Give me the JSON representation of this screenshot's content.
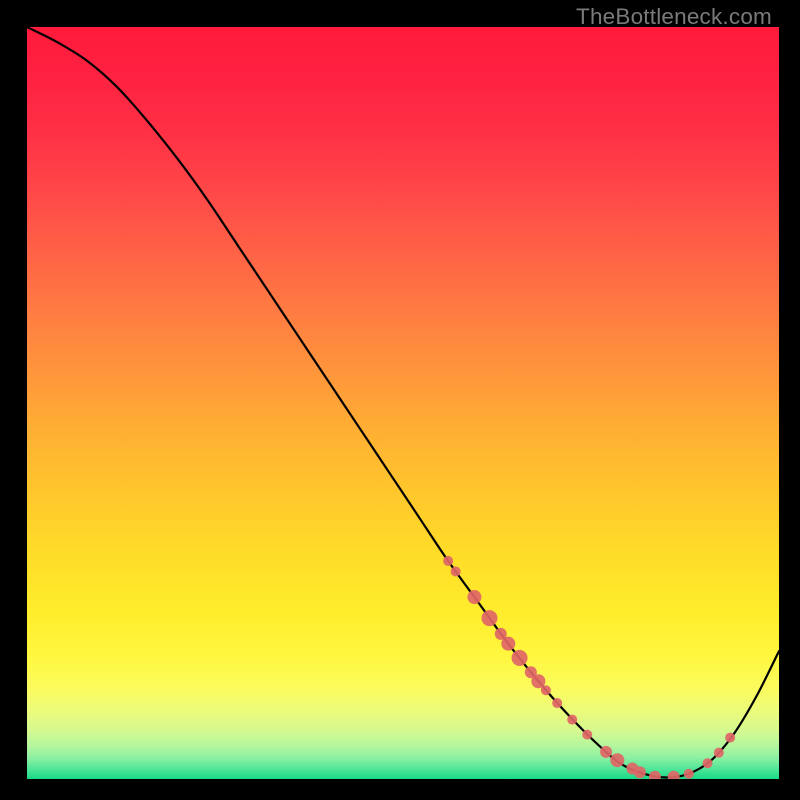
{
  "watermark": "TheBottleneck.com",
  "colors": {
    "gradient_stops": [
      {
        "offset": 0.0,
        "color": "#ff1a3a"
      },
      {
        "offset": 0.06,
        "color": "#ff2141"
      },
      {
        "offset": 0.14,
        "color": "#ff3045"
      },
      {
        "offset": 0.22,
        "color": "#ff4848"
      },
      {
        "offset": 0.3,
        "color": "#ff6246"
      },
      {
        "offset": 0.38,
        "color": "#ff7c42"
      },
      {
        "offset": 0.46,
        "color": "#ff963b"
      },
      {
        "offset": 0.54,
        "color": "#ffb033"
      },
      {
        "offset": 0.62,
        "color": "#ffc72c"
      },
      {
        "offset": 0.7,
        "color": "#ffdc28"
      },
      {
        "offset": 0.78,
        "color": "#ffed2c"
      },
      {
        "offset": 0.84,
        "color": "#fff741"
      },
      {
        "offset": 0.88,
        "color": "#fbfb5e"
      },
      {
        "offset": 0.91,
        "color": "#ecfb7b"
      },
      {
        "offset": 0.935,
        "color": "#d6f98f"
      },
      {
        "offset": 0.955,
        "color": "#b6f69d"
      },
      {
        "offset": 0.972,
        "color": "#8cf0a1"
      },
      {
        "offset": 0.985,
        "color": "#57e79a"
      },
      {
        "offset": 1.0,
        "color": "#17da87"
      }
    ],
    "curve": "#000000",
    "dot_fill": "#e06666",
    "dot_stroke": "#d85a5a"
  },
  "chart_data": {
    "type": "line",
    "title": "",
    "xlabel": "",
    "ylabel": "",
    "xlim": [
      0,
      100
    ],
    "ylim": [
      0,
      100
    ],
    "series": [
      {
        "name": "bottleneck-curve",
        "x": [
          0,
          4,
          8,
          12,
          16,
          20,
          24,
          28,
          32,
          36,
          40,
          44,
          48,
          52,
          56,
          60,
          64,
          68,
          72,
          76,
          79,
          82,
          85,
          88,
          91,
          94,
          97,
          100
        ],
        "y": [
          100,
          98,
          95.5,
          92,
          87.5,
          82.5,
          77,
          71,
          65,
          59,
          53,
          47,
          41,
          35,
          29,
          23.5,
          18,
          13,
          8.5,
          4.5,
          2.0,
          0.7,
          0.2,
          0.7,
          2.5,
          6.0,
          11,
          17
        ]
      }
    ],
    "dots": {
      "name": "highlight-points",
      "points": [
        {
          "x": 56.0,
          "y": 29.0,
          "r": 5
        },
        {
          "x": 57.0,
          "y": 27.6,
          "r": 5
        },
        {
          "x": 59.5,
          "y": 24.2,
          "r": 7
        },
        {
          "x": 61.5,
          "y": 21.4,
          "r": 8
        },
        {
          "x": 63.0,
          "y": 19.3,
          "r": 6
        },
        {
          "x": 64.0,
          "y": 18.0,
          "r": 7
        },
        {
          "x": 65.5,
          "y": 16.1,
          "r": 8
        },
        {
          "x": 67.0,
          "y": 14.2,
          "r": 6
        },
        {
          "x": 68.0,
          "y": 13.0,
          "r": 7
        },
        {
          "x": 69.0,
          "y": 11.8,
          "r": 5
        },
        {
          "x": 70.5,
          "y": 10.1,
          "r": 5
        },
        {
          "x": 72.5,
          "y": 7.9,
          "r": 5
        },
        {
          "x": 74.5,
          "y": 5.9,
          "r": 5
        },
        {
          "x": 77.0,
          "y": 3.6,
          "r": 6
        },
        {
          "x": 78.5,
          "y": 2.5,
          "r": 7
        },
        {
          "x": 80.5,
          "y": 1.4,
          "r": 6
        },
        {
          "x": 81.5,
          "y": 0.9,
          "r": 6
        },
        {
          "x": 83.5,
          "y": 0.3,
          "r": 6
        },
        {
          "x": 86.0,
          "y": 0.3,
          "r": 6
        },
        {
          "x": 88.0,
          "y": 0.7,
          "r": 5
        },
        {
          "x": 90.5,
          "y": 2.1,
          "r": 5
        },
        {
          "x": 92.0,
          "y": 3.5,
          "r": 5
        },
        {
          "x": 93.5,
          "y": 5.5,
          "r": 5
        }
      ]
    }
  }
}
